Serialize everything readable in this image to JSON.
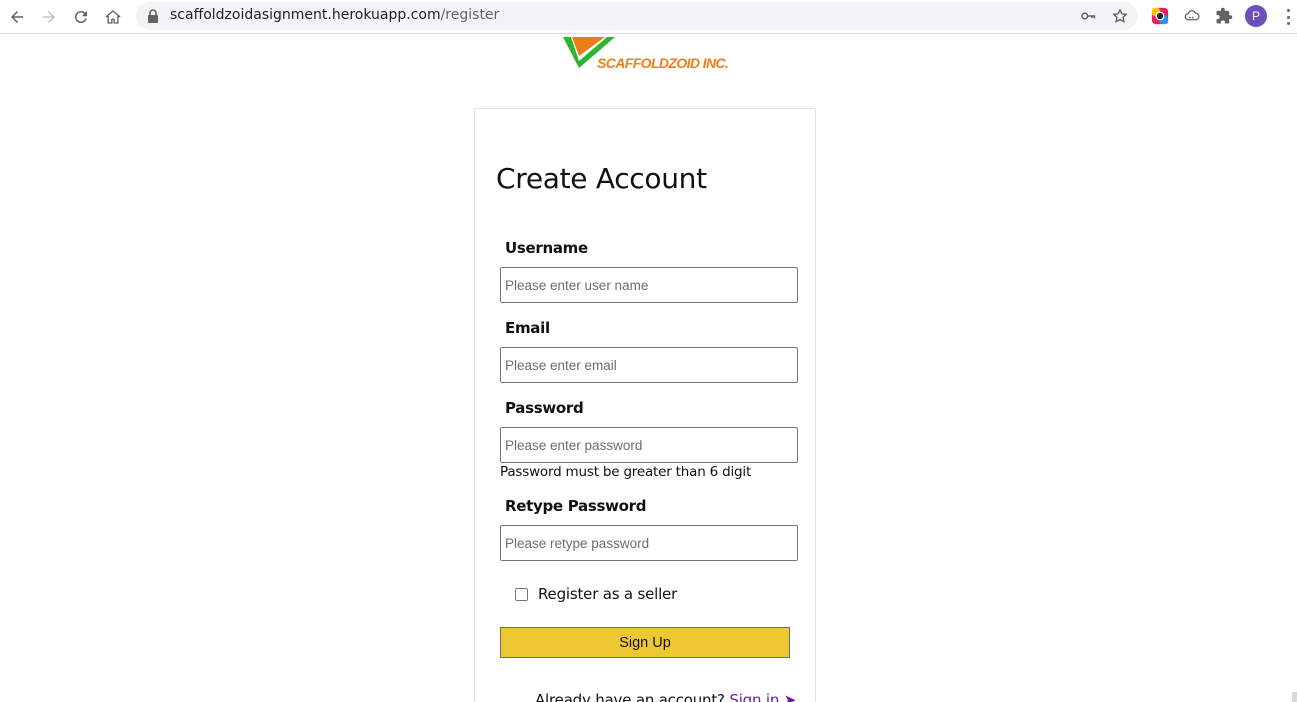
{
  "browser": {
    "url_host": "scaffoldzoidasignment.herokuapp.com",
    "url_path": "/register",
    "profile_initial": "P"
  },
  "logo": {
    "text": "SCAFFOLDZOID INC."
  },
  "form": {
    "title": "Create Account",
    "username": {
      "label": "Username",
      "placeholder": "Please enter user name",
      "value": ""
    },
    "email": {
      "label": "Email",
      "placeholder": "Please enter email",
      "value": ""
    },
    "password": {
      "label": "Password",
      "placeholder": "Please enter password",
      "value": "",
      "hint": "Password must be greater than 6 digit"
    },
    "retype_password": {
      "label": "Retype Password",
      "placeholder": "Please retype password",
      "value": ""
    },
    "seller_checkbox": {
      "label": "Register as a seller",
      "checked": false
    },
    "submit_label": "Sign Up",
    "footer": {
      "text": "Already have an account?",
      "link": "Sign in",
      "link_icon": "➤"
    }
  },
  "colors": {
    "accent_button": "#edc833",
    "logo_orange": "#ef7d16",
    "logo_green": "#2db52d",
    "link": "#6a1b9a"
  }
}
